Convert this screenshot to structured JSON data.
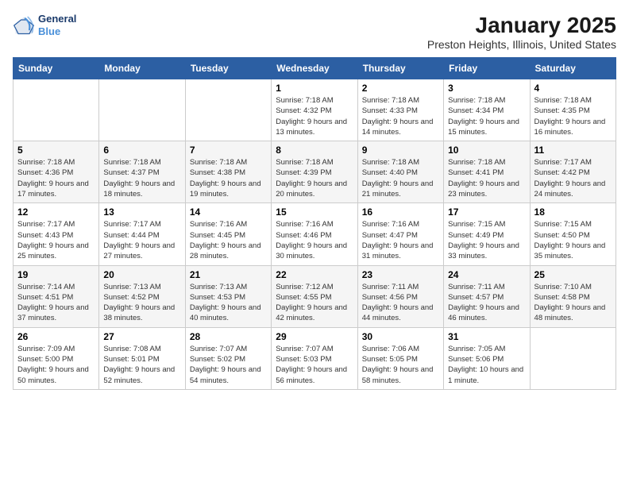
{
  "header": {
    "logo_line1": "General",
    "logo_line2": "Blue",
    "month": "January 2025",
    "location": "Preston Heights, Illinois, United States"
  },
  "weekdays": [
    "Sunday",
    "Monday",
    "Tuesday",
    "Wednesday",
    "Thursday",
    "Friday",
    "Saturday"
  ],
  "weeks": [
    [
      {
        "day": "",
        "info": ""
      },
      {
        "day": "",
        "info": ""
      },
      {
        "day": "",
        "info": ""
      },
      {
        "day": "1",
        "info": "Sunrise: 7:18 AM\nSunset: 4:32 PM\nDaylight: 9 hours\nand 13 minutes."
      },
      {
        "day": "2",
        "info": "Sunrise: 7:18 AM\nSunset: 4:33 PM\nDaylight: 9 hours\nand 14 minutes."
      },
      {
        "day": "3",
        "info": "Sunrise: 7:18 AM\nSunset: 4:34 PM\nDaylight: 9 hours\nand 15 minutes."
      },
      {
        "day": "4",
        "info": "Sunrise: 7:18 AM\nSunset: 4:35 PM\nDaylight: 9 hours\nand 16 minutes."
      }
    ],
    [
      {
        "day": "5",
        "info": "Sunrise: 7:18 AM\nSunset: 4:36 PM\nDaylight: 9 hours\nand 17 minutes."
      },
      {
        "day": "6",
        "info": "Sunrise: 7:18 AM\nSunset: 4:37 PM\nDaylight: 9 hours\nand 18 minutes."
      },
      {
        "day": "7",
        "info": "Sunrise: 7:18 AM\nSunset: 4:38 PM\nDaylight: 9 hours\nand 19 minutes."
      },
      {
        "day": "8",
        "info": "Sunrise: 7:18 AM\nSunset: 4:39 PM\nDaylight: 9 hours\nand 20 minutes."
      },
      {
        "day": "9",
        "info": "Sunrise: 7:18 AM\nSunset: 4:40 PM\nDaylight: 9 hours\nand 21 minutes."
      },
      {
        "day": "10",
        "info": "Sunrise: 7:18 AM\nSunset: 4:41 PM\nDaylight: 9 hours\nand 23 minutes."
      },
      {
        "day": "11",
        "info": "Sunrise: 7:17 AM\nSunset: 4:42 PM\nDaylight: 9 hours\nand 24 minutes."
      }
    ],
    [
      {
        "day": "12",
        "info": "Sunrise: 7:17 AM\nSunset: 4:43 PM\nDaylight: 9 hours\nand 25 minutes."
      },
      {
        "day": "13",
        "info": "Sunrise: 7:17 AM\nSunset: 4:44 PM\nDaylight: 9 hours\nand 27 minutes."
      },
      {
        "day": "14",
        "info": "Sunrise: 7:16 AM\nSunset: 4:45 PM\nDaylight: 9 hours\nand 28 minutes."
      },
      {
        "day": "15",
        "info": "Sunrise: 7:16 AM\nSunset: 4:46 PM\nDaylight: 9 hours\nand 30 minutes."
      },
      {
        "day": "16",
        "info": "Sunrise: 7:16 AM\nSunset: 4:47 PM\nDaylight: 9 hours\nand 31 minutes."
      },
      {
        "day": "17",
        "info": "Sunrise: 7:15 AM\nSunset: 4:49 PM\nDaylight: 9 hours\nand 33 minutes."
      },
      {
        "day": "18",
        "info": "Sunrise: 7:15 AM\nSunset: 4:50 PM\nDaylight: 9 hours\nand 35 minutes."
      }
    ],
    [
      {
        "day": "19",
        "info": "Sunrise: 7:14 AM\nSunset: 4:51 PM\nDaylight: 9 hours\nand 37 minutes."
      },
      {
        "day": "20",
        "info": "Sunrise: 7:13 AM\nSunset: 4:52 PM\nDaylight: 9 hours\nand 38 minutes."
      },
      {
        "day": "21",
        "info": "Sunrise: 7:13 AM\nSunset: 4:53 PM\nDaylight: 9 hours\nand 40 minutes."
      },
      {
        "day": "22",
        "info": "Sunrise: 7:12 AM\nSunset: 4:55 PM\nDaylight: 9 hours\nand 42 minutes."
      },
      {
        "day": "23",
        "info": "Sunrise: 7:11 AM\nSunset: 4:56 PM\nDaylight: 9 hours\nand 44 minutes."
      },
      {
        "day": "24",
        "info": "Sunrise: 7:11 AM\nSunset: 4:57 PM\nDaylight: 9 hours\nand 46 minutes."
      },
      {
        "day": "25",
        "info": "Sunrise: 7:10 AM\nSunset: 4:58 PM\nDaylight: 9 hours\nand 48 minutes."
      }
    ],
    [
      {
        "day": "26",
        "info": "Sunrise: 7:09 AM\nSunset: 5:00 PM\nDaylight: 9 hours\nand 50 minutes."
      },
      {
        "day": "27",
        "info": "Sunrise: 7:08 AM\nSunset: 5:01 PM\nDaylight: 9 hours\nand 52 minutes."
      },
      {
        "day": "28",
        "info": "Sunrise: 7:07 AM\nSunset: 5:02 PM\nDaylight: 9 hours\nand 54 minutes."
      },
      {
        "day": "29",
        "info": "Sunrise: 7:07 AM\nSunset: 5:03 PM\nDaylight: 9 hours\nand 56 minutes."
      },
      {
        "day": "30",
        "info": "Sunrise: 7:06 AM\nSunset: 5:05 PM\nDaylight: 9 hours\nand 58 minutes."
      },
      {
        "day": "31",
        "info": "Sunrise: 7:05 AM\nSunset: 5:06 PM\nDaylight: 10 hours\nand 1 minute."
      },
      {
        "day": "",
        "info": ""
      }
    ]
  ]
}
